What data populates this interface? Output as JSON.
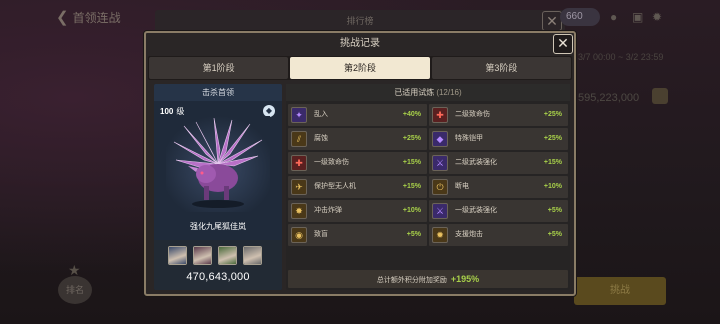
{
  "background": {
    "back_label": "首领连战",
    "title_tab": "排行榜",
    "currency": "660",
    "date_range": "3/7 00:00 ~ 3/2 23:59",
    "score": "595,223,000",
    "fight_label": "挑战",
    "rank_label": "排名"
  },
  "dialog": {
    "title": "挑战记录",
    "close_symbol": "✕",
    "tabs": [
      {
        "label": "第1阶段",
        "active": false
      },
      {
        "label": "第2阶段",
        "active": true
      },
      {
        "label": "第3阶段",
        "active": false
      }
    ]
  },
  "boss": {
    "header": "击杀首领",
    "level_num": "100",
    "level_unit": "级",
    "name": "强化九尾狐佳岚",
    "score": "470,643,000",
    "hero_colors": [
      "#3a4a6a",
      "#5a3a4a",
      "#4a6a3a",
      "#6a6a6a"
    ]
  },
  "trials": {
    "header": "已适用试炼",
    "count": "(12/16)",
    "items": [
      {
        "name": "乱入",
        "value": "+40%",
        "icon": "chaos-icon",
        "color": "blue",
        "glyph": "✦"
      },
      {
        "name": "二级致命伤",
        "value": "+25%",
        "icon": "critical-wound-icon",
        "color": "red",
        "glyph": "✚"
      },
      {
        "name": "腐蚀",
        "value": "+25%",
        "icon": "corrosion-icon",
        "color": "gold",
        "glyph": "⫽"
      },
      {
        "name": "特殊铠甲",
        "value": "+25%",
        "icon": "special-armor-icon",
        "color": "blue",
        "glyph": "◆"
      },
      {
        "name": "一级致命伤",
        "value": "+15%",
        "icon": "critical-wound-icon",
        "color": "red",
        "glyph": "✚"
      },
      {
        "name": "二级武装强化",
        "value": "+15%",
        "icon": "weapon-enhance-icon",
        "color": "blue",
        "glyph": "⚔"
      },
      {
        "name": "保护型无人机",
        "value": "+15%",
        "icon": "drone-icon",
        "color": "gold",
        "glyph": "✈"
      },
      {
        "name": "断电",
        "value": "+10%",
        "icon": "power-cut-icon",
        "color": "gold",
        "glyph": "⏻"
      },
      {
        "name": "冲击炸弹",
        "value": "+10%",
        "icon": "bomb-icon",
        "color": "gold",
        "glyph": "✸"
      },
      {
        "name": "一级武装强化",
        "value": "+5%",
        "icon": "weapon-enhance-icon",
        "color": "blue",
        "glyph": "⚔"
      },
      {
        "name": "致盲",
        "value": "+5%",
        "icon": "blind-icon",
        "color": "gold",
        "glyph": "◉"
      },
      {
        "name": "支援炮击",
        "value": "+5%",
        "icon": "artillery-icon",
        "color": "gold",
        "glyph": "✹"
      }
    ],
    "total_label": "总计额外积分附加奖励",
    "total_value": "+195%"
  }
}
